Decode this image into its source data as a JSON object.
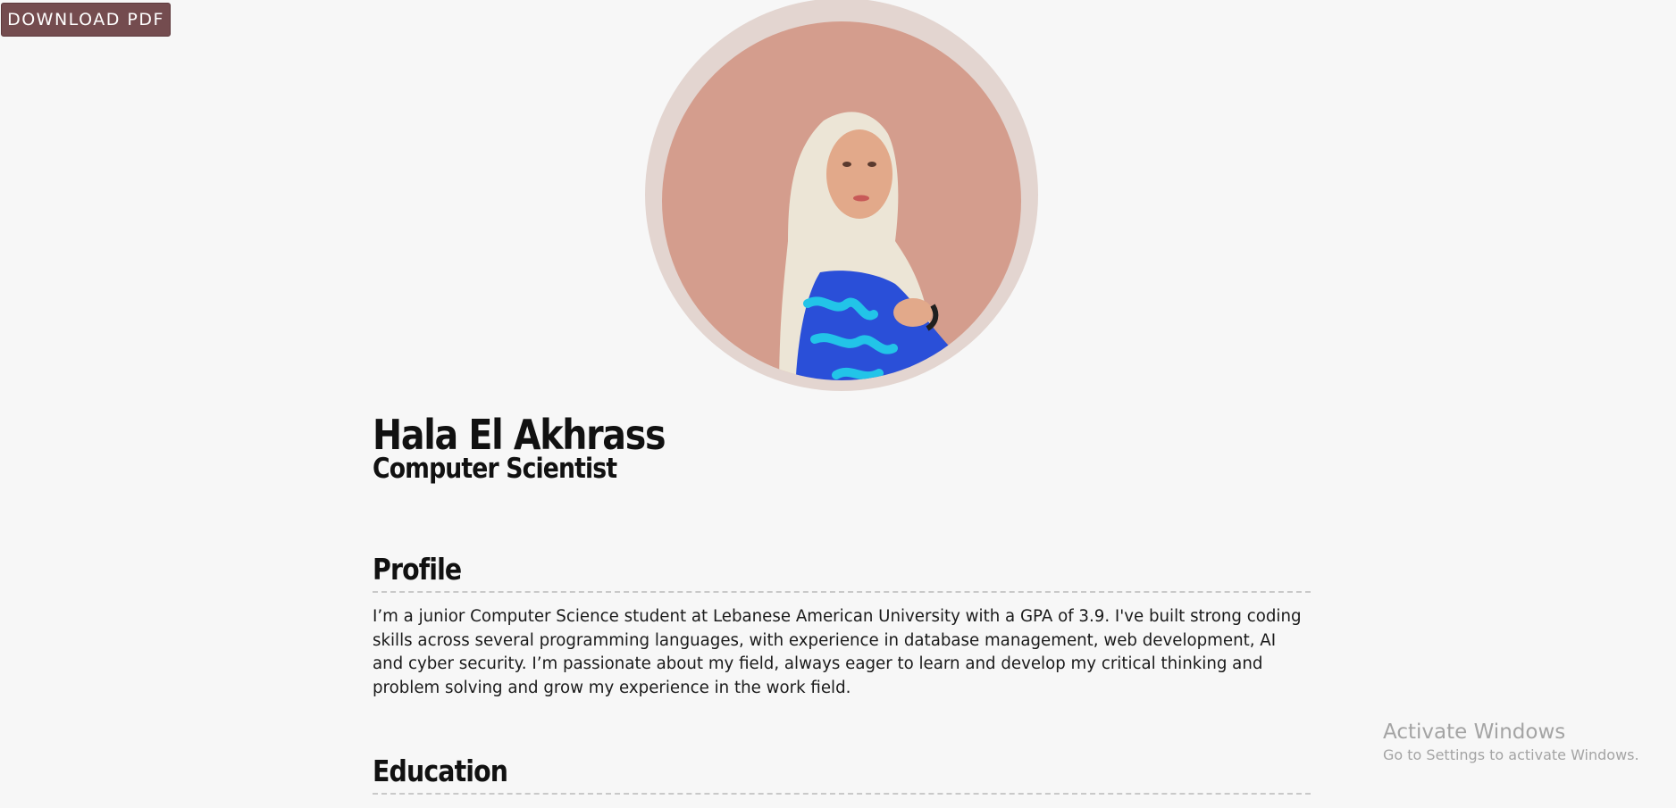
{
  "toolbar": {
    "download_label": "DOWNLOAD PDF"
  },
  "header": {
    "name": "Hala El Akhrass",
    "title": "Computer Scientist"
  },
  "sections": [
    {
      "heading": "Profile",
      "text": "I’m a junior Computer Science student at Lebanese American University with a GPA of 3.9. I've built strong coding skills across several programming languages, with experience in database management, web development, AI and cyber security. I’m passionate about my field, always eager to learn and develop my critical thinking and problem solving and grow my experience in the work field."
    },
    {
      "heading": "Education",
      "text": ""
    }
  ],
  "watermark": {
    "title": "Activate Windows",
    "subtitle": "Go to Settings to activate Windows."
  },
  "colors": {
    "page_background": "#f7f7f7",
    "button_background": "#744c4f",
    "avatar_outer_ring": "#e3d5d0",
    "avatar_inner_circle": "#d49d8d",
    "divider": "#c9c9c9"
  }
}
